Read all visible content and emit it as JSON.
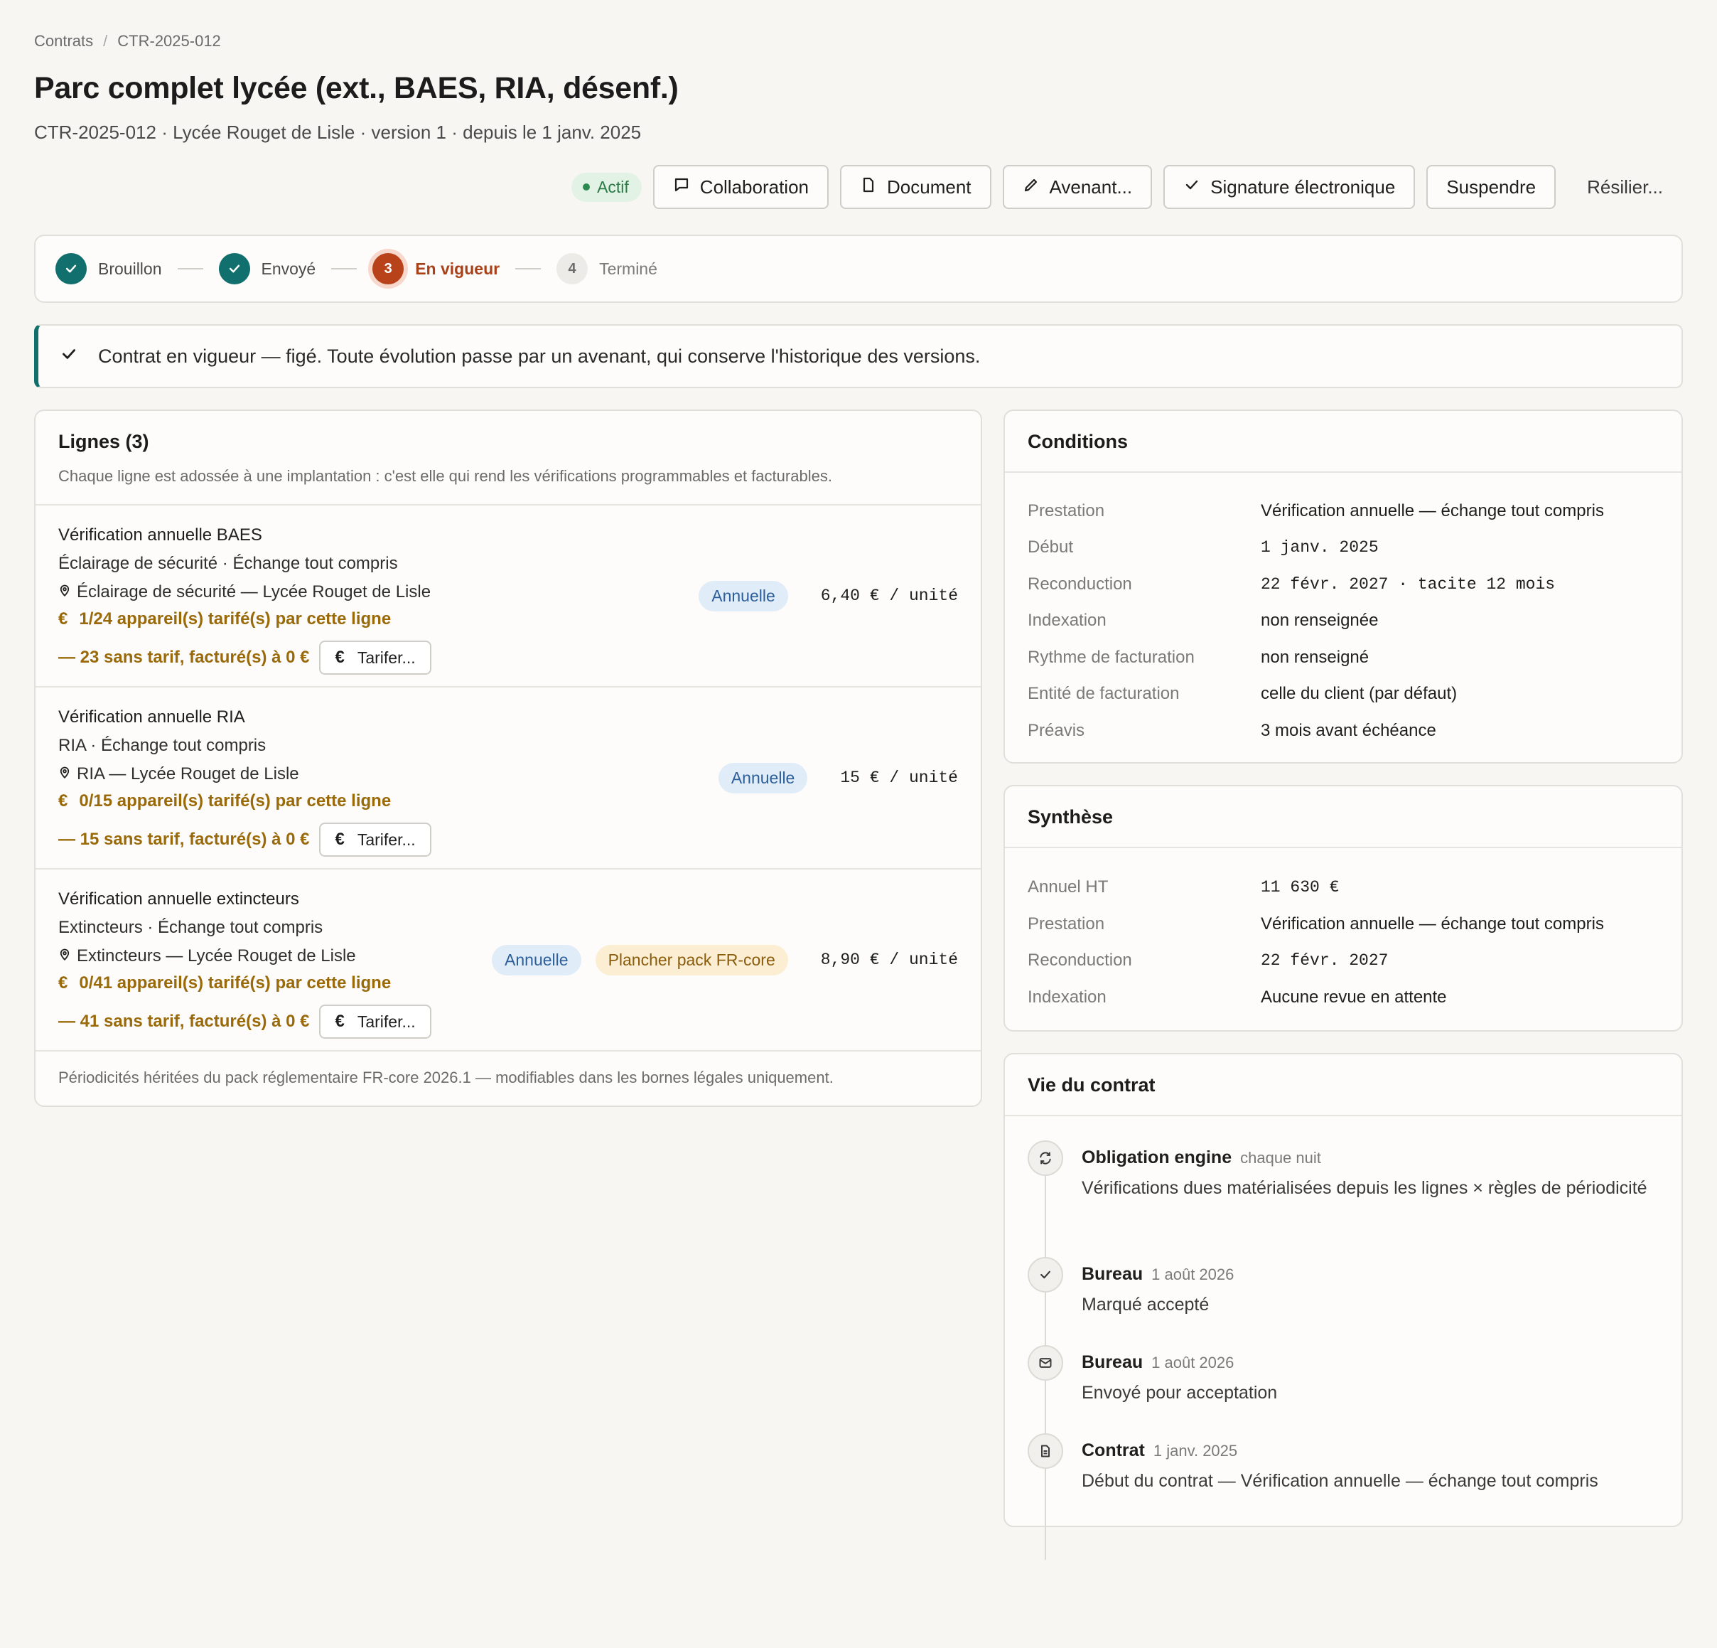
{
  "breadcrumb": {
    "root": "Contrats",
    "separator": "/",
    "current": "CTR-2025-012"
  },
  "page": {
    "title": "Parc complet lycée (ext., BAES, RIA, désenf.)",
    "subtitle": "CTR-2025-012 · Lycée Rouget de Lisle · version 1 · depuis le 1 janv. 2025"
  },
  "actions": {
    "status": "Actif",
    "collaboration": "Collaboration",
    "document": "Document",
    "avenant": "Avenant...",
    "signature": "Signature électronique",
    "suspend": "Suspendre",
    "terminate": "Résilier..."
  },
  "stepper": [
    {
      "num": "1",
      "label": "Brouillon",
      "state": "done"
    },
    {
      "num": "2",
      "label": "Envoyé",
      "state": "done"
    },
    {
      "num": "3",
      "label": "En vigueur",
      "state": "current"
    },
    {
      "num": "4",
      "label": "Terminé",
      "state": "todo"
    }
  ],
  "banner": {
    "text": "Contrat en vigueur — figé. Toute évolution passe par un avenant, qui conserve l'historique des versions."
  },
  "lines": {
    "title": "Lignes (3)",
    "description": "Chaque ligne est adossée à une implantation : c'est elle qui rend les vérifications programmables et facturables.",
    "items": [
      {
        "title": "Vérification annuelle BAES",
        "sub": "Éclairage de sécurité · Échange tout compris",
        "location": "Éclairage de sécurité — Lycée Rouget de Lisle",
        "priced": "1/24 appareil(s) tarifé(s) par cette ligne",
        "unpriced": "— 23 sans tarif, facturé(s) à 0 €",
        "button": "Tarifer...",
        "frequency": "Annuelle",
        "pack": "",
        "price": "6,40 € / unité"
      },
      {
        "title": "Vérification annuelle RIA",
        "sub": "RIA · Échange tout compris",
        "location": "RIA — Lycée Rouget de Lisle",
        "priced": "0/15 appareil(s) tarifé(s) par cette ligne",
        "unpriced": "— 15 sans tarif, facturé(s) à 0 €",
        "button": "Tarifer...",
        "frequency": "Annuelle",
        "pack": "",
        "price": "15 € / unité"
      },
      {
        "title": "Vérification annuelle extincteurs",
        "sub": "Extincteurs · Échange tout compris",
        "location": "Extincteurs — Lycée Rouget de Lisle",
        "priced": "0/41 appareil(s) tarifé(s) par cette ligne",
        "unpriced": "— 41 sans tarif, facturé(s) à 0 €",
        "button": "Tarifer...",
        "frequency": "Annuelle",
        "pack": "Plancher pack FR-core",
        "price": "8,90 € / unité"
      }
    ],
    "euro_symbol": "€",
    "footer": "Périodicités héritées du pack réglementaire FR-core 2026.1 — modifiables dans les bornes légales uniquement."
  },
  "conditions": {
    "title": "Conditions",
    "rows": [
      {
        "k": "Prestation",
        "v": "Vérification annuelle — échange tout compris",
        "mono": false
      },
      {
        "k": "Début",
        "v": "1 janv. 2025",
        "mono": true
      },
      {
        "k": "Reconduction",
        "v": "22 févr. 2027 · tacite 12 mois",
        "mono": true
      },
      {
        "k": "Indexation",
        "v": "non renseignée",
        "mono": false
      },
      {
        "k": "Rythme de facturation",
        "v": "non renseigné",
        "mono": false
      },
      {
        "k": "Entité de facturation",
        "v": "celle du client (par défaut)",
        "mono": false
      },
      {
        "k": "Préavis",
        "v": "3 mois avant échéance",
        "mono": false
      }
    ]
  },
  "summary": {
    "title": "Synthèse",
    "rows": [
      {
        "k": "Annuel HT",
        "v": "11 630 €",
        "mono": true
      },
      {
        "k": "Prestation",
        "v": "Vérification annuelle — échange tout compris",
        "mono": false
      },
      {
        "k": "Reconduction",
        "v": "22 févr. 2027",
        "mono": true
      },
      {
        "k": "Indexation",
        "v": "Aucune revue en attente",
        "mono": false
      }
    ]
  },
  "lifecycle": {
    "title": "Vie du contrat",
    "events": [
      {
        "icon": "sync-icon",
        "who": "Obligation engine",
        "when": "chaque nuit",
        "text": "Vérifications dues matérialisées depuis les lignes × règles de périodicité"
      },
      {
        "icon": "check-icon",
        "who": "Bureau",
        "when": "1 août 2026",
        "text": "Marqué accepté"
      },
      {
        "icon": "mail-icon",
        "who": "Bureau",
        "when": "1 août 2026",
        "text": "Envoyé pour acceptation"
      },
      {
        "icon": "document-icon",
        "who": "Contrat",
        "when": "1 janv. 2025",
        "text": "Début du contrat — Vérification annuelle — échange tout compris"
      }
    ]
  },
  "colors": {
    "teal": "#11706d",
    "current_step": "#b8431a",
    "warning_amber": "#9a6a0a",
    "active_green": "#2c7a45"
  }
}
